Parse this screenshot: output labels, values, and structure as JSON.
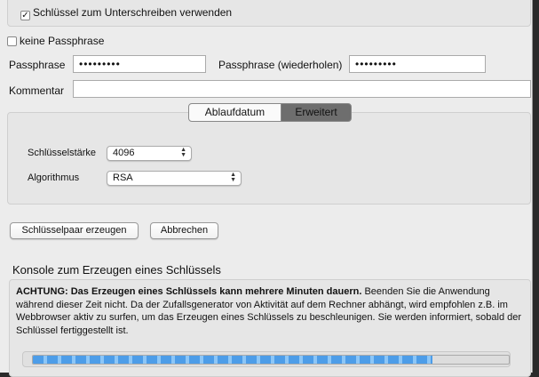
{
  "signing": {
    "checked": true,
    "label": "Schlüssel zum Unterschreiben verwenden"
  },
  "no_passphrase": {
    "checked": false,
    "label": "keine Passphrase"
  },
  "passphrase": {
    "label": "Passphrase",
    "value": "•••••••••"
  },
  "passphrase_repeat": {
    "label": "Passphrase (wiederholen)",
    "value": "•••••••••"
  },
  "comment": {
    "label": "Kommentar",
    "value": ""
  },
  "tabs": [
    {
      "label": "Ablaufdatum",
      "active": false
    },
    {
      "label": "Erweitert",
      "active": true
    }
  ],
  "key_strength": {
    "label": "Schlüsselstärke",
    "value": "4096"
  },
  "algorithm": {
    "label": "Algorithmus",
    "value": "RSA"
  },
  "buttons": {
    "generate": "Schlüsselpaar erzeugen",
    "cancel": "Abbrechen"
  },
  "console": {
    "title": "Konsole zum Erzeugen eines Schlüssels",
    "warning_bold": "ACHTUNG: Das Erzeugen eines Schlüssels kann mehrere Minuten dauern.",
    "warning_text": " Beenden Sie die Anwendung während dieser Zeit nicht. Da der Zufallsgenerator von Aktivität auf dem Rechner abhängt, wird empfohlen z.B. im Webbrowser aktiv zu surfen, um das Erzeugen eines Schlüssels zu beschleunigen. Sie werden informiert, sobald der Schlüssel fertiggestellt ist.",
    "progress_percent": 84
  },
  "colors": {
    "progress": "#5aa6ef",
    "active_tab": "#6e6e6e"
  }
}
